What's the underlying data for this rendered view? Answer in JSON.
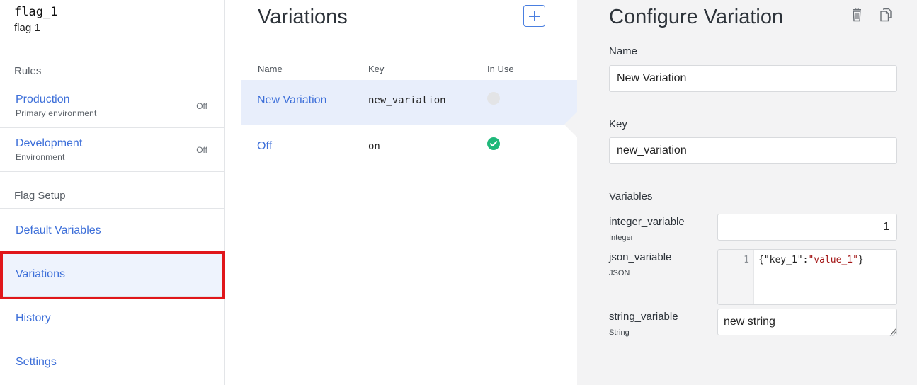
{
  "sidebar": {
    "flag_key": "flag_1",
    "flag_name": "flag 1",
    "rules_label": "Rules",
    "environments": [
      {
        "name": "Production",
        "subtitle": "Primary environment",
        "status": "Off"
      },
      {
        "name": "Development",
        "subtitle": "Environment",
        "status": "Off"
      }
    ],
    "setup_label": "Flag Setup",
    "nav": [
      {
        "label": "Default Variables"
      },
      {
        "label": "Variations",
        "active": true
      },
      {
        "label": "History"
      },
      {
        "label": "Settings"
      }
    ]
  },
  "variations": {
    "title": "Variations",
    "add_icon": "plus-icon",
    "columns": {
      "name": "Name",
      "key": "Key",
      "in_use": "In Use"
    },
    "rows": [
      {
        "name": "New Variation",
        "key": "new_variation",
        "in_use": false,
        "selected": true
      },
      {
        "name": "Off",
        "key": "on",
        "in_use": true,
        "selected": false
      }
    ]
  },
  "configure": {
    "title": "Configure Variation",
    "delete_icon": "trash-icon",
    "copy_icon": "copy-icon",
    "name_label": "Name",
    "name_value": "New Variation",
    "key_label": "Key",
    "key_value": "new_variation",
    "variables_label": "Variables",
    "variables": {
      "integer": {
        "name": "integer_variable",
        "type": "Integer",
        "value": "1"
      },
      "json": {
        "name": "json_variable",
        "type": "JSON",
        "line_number": "1",
        "tokens": {
          "open": "{\"key_1\":",
          "value": "\"value_1\"",
          "close": "}"
        }
      },
      "string": {
        "name": "string_variable",
        "type": "String",
        "value": "new string"
      }
    }
  },
  "colors": {
    "link": "#3d6fd9",
    "selected_row": "#e8eefb",
    "active_nav": "#eef3fd",
    "in_use_on": "#1fb87a",
    "in_use_off": "#e3e4e6",
    "panel_bg": "#f3f3f4",
    "highlight": "#e0161b"
  }
}
